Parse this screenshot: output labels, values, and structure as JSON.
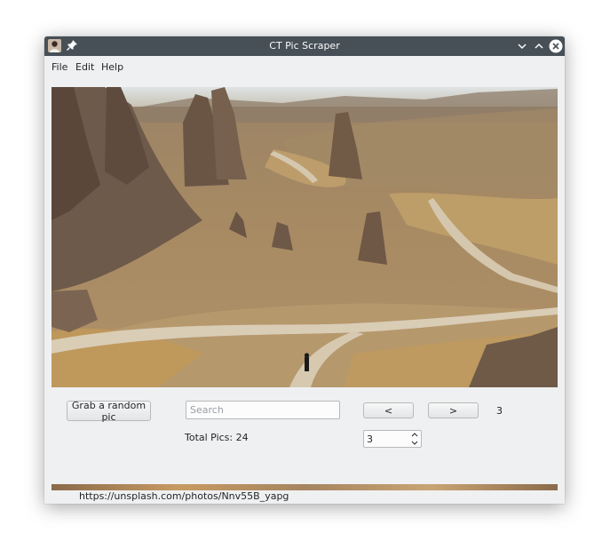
{
  "window": {
    "title": "CT Pic Scraper"
  },
  "menu": [
    "File",
    "Edit",
    "Help"
  ],
  "controls": {
    "grab_label": "Grab a random pic",
    "search_placeholder": "Search",
    "prev_label": "<",
    "next_label": ">",
    "current_index": "3",
    "total_pics": "Total Pics: 24",
    "spin_value": "3"
  },
  "status": {
    "url": "https://unsplash.com/photos/Nnv55B_yapg"
  },
  "icons": {
    "app": "app-avatar-icon",
    "pin": "pin-icon",
    "minimize": "chevron-down-icon",
    "maximize": "chevron-up-icon",
    "close": "close-icon",
    "spin_up": "chevron-up-icon",
    "spin_down": "chevron-down-icon"
  },
  "colors": {
    "titlebar": "#475057",
    "window_bg": "#eff0f1",
    "text": "#232629"
  }
}
